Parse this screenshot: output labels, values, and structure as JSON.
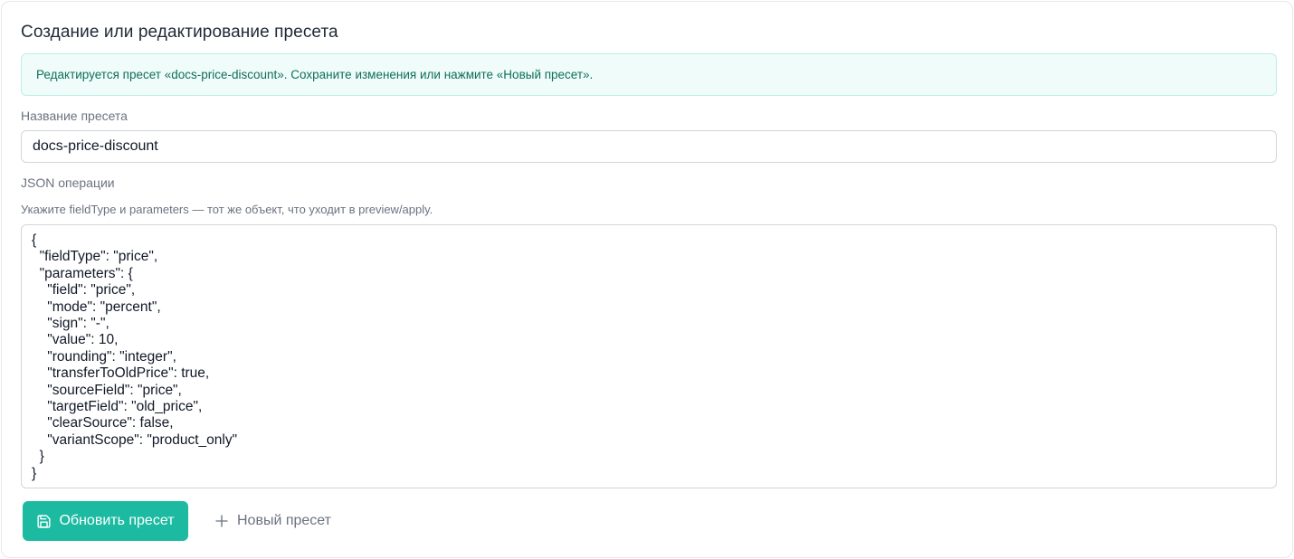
{
  "panel": {
    "title": "Создание или редактирование пресета",
    "notice": "Редактируется пресет «docs-price-discount». Сохраните изменения или нажмите «Новый пресет»."
  },
  "form": {
    "name_label": "Название пресета",
    "name_value": "docs-price-discount",
    "json_label": "JSON операции",
    "json_hint": "Укажите fieldType и parameters — тот же объект, что уходит в preview/apply.",
    "json_value": "{\n  \"fieldType\": \"price\",\n  \"parameters\": {\n    \"field\": \"price\",\n    \"mode\": \"percent\",\n    \"sign\": \"-\",\n    \"value\": 10,\n    \"rounding\": \"integer\",\n    \"transferToOldPrice\": true,\n    \"sourceField\": \"price\",\n    \"targetField\": \"old_price\",\n    \"clearSource\": false,\n    \"variantScope\": \"product_only\"\n  }\n}"
  },
  "actions": {
    "update_label": "Обновить пресет",
    "update_icon": "save-icon",
    "new_label": "Новый пресет",
    "new_icon": "plus-icon"
  },
  "colors": {
    "accent": "#1dbaa2",
    "notice_bg": "#effcf9",
    "notice_text": "#0f6e5c"
  }
}
